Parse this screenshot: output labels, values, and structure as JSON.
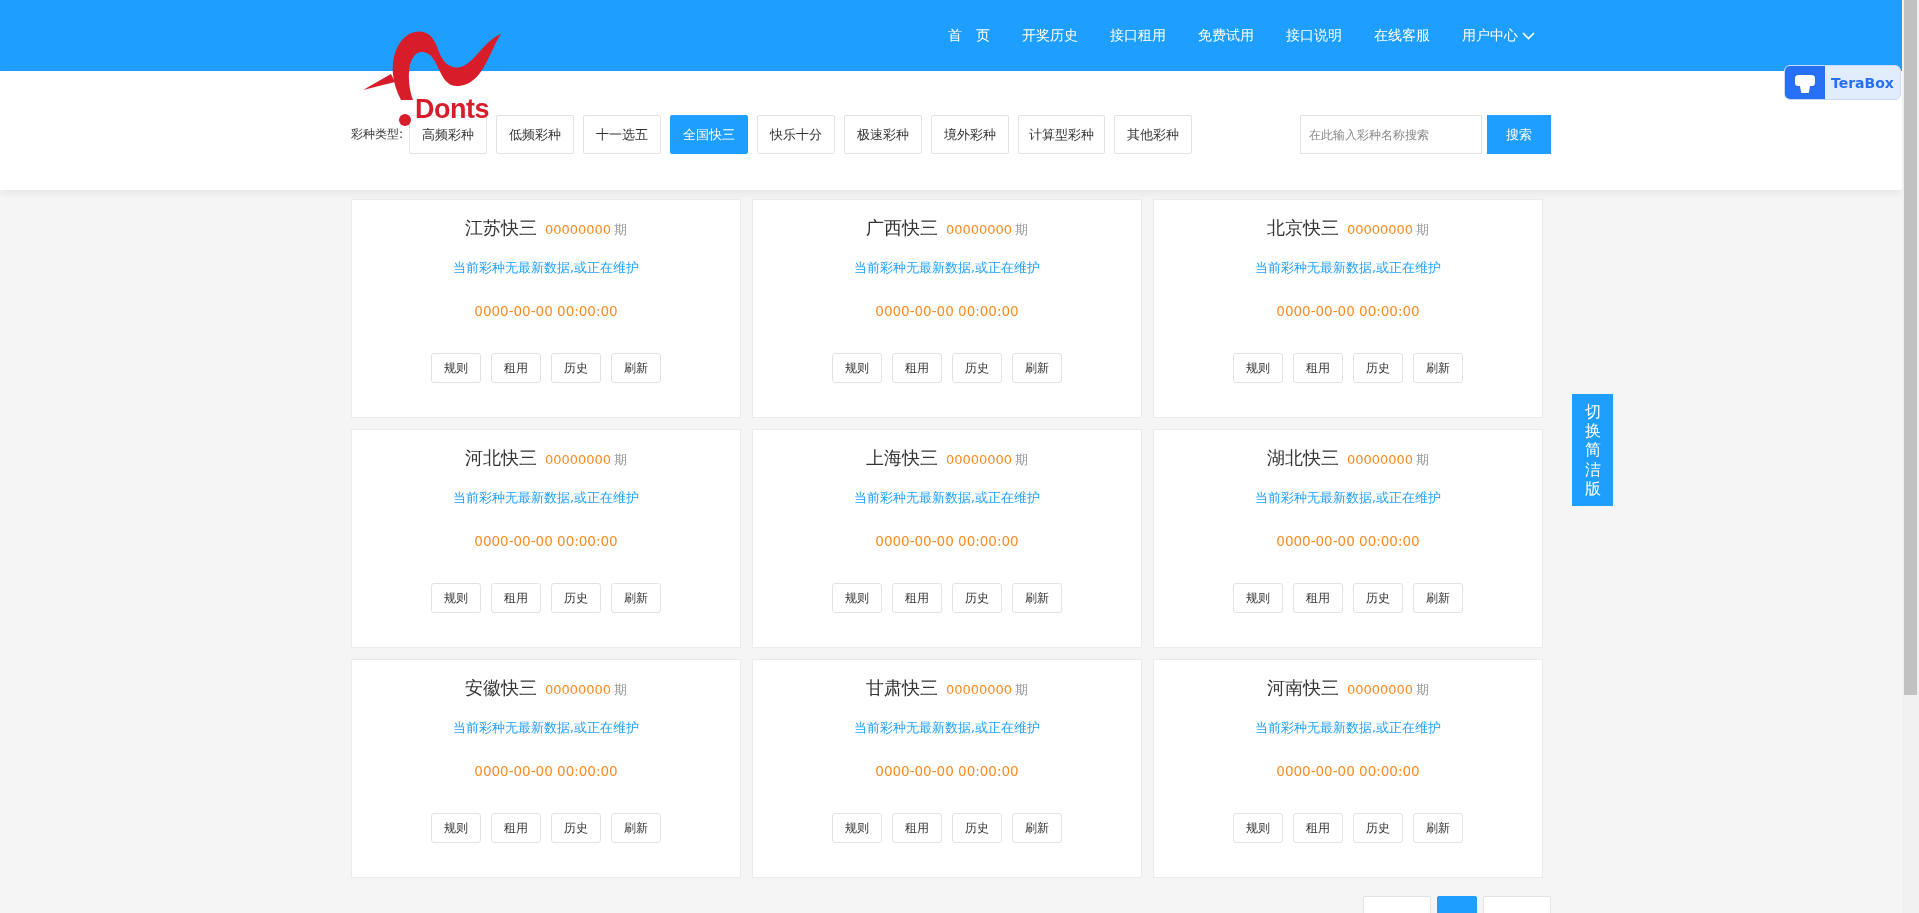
{
  "logo": {
    "text": "Donts"
  },
  "nav": {
    "items": [
      {
        "label": "首　页"
      },
      {
        "label": "开奖历史"
      },
      {
        "label": "接口租用"
      },
      {
        "label": "免费试用"
      },
      {
        "label": "接口说明"
      },
      {
        "label": "在线客服"
      },
      {
        "label": "用户中心",
        "dropdown": true
      }
    ]
  },
  "filter": {
    "label": "彩种类型:",
    "types": [
      {
        "label": "高频彩种",
        "selected": false
      },
      {
        "label": "低频彩种",
        "selected": false
      },
      {
        "label": "十一选五",
        "selected": false
      },
      {
        "label": "全国快三",
        "selected": true
      },
      {
        "label": "快乐十分",
        "selected": false
      },
      {
        "label": "极速彩种",
        "selected": false
      },
      {
        "label": "境外彩种",
        "selected": false
      },
      {
        "label": "计算型彩种",
        "selected": false
      },
      {
        "label": "其他彩种",
        "selected": false
      }
    ],
    "search": {
      "placeholder": "在此输入彩种名称搜索",
      "button": "搜索"
    }
  },
  "cards": [
    {
      "name": "江苏快三",
      "issue": "00000000",
      "issue_unit": "期",
      "message": "当前彩种无最新数据,或正在维护",
      "time": "0000-00-00 00:00:00",
      "actions": [
        "规则",
        "租用",
        "历史",
        "刷新"
      ]
    },
    {
      "name": "广西快三",
      "issue": "00000000",
      "issue_unit": "期",
      "message": "当前彩种无最新数据,或正在维护",
      "time": "0000-00-00 00:00:00",
      "actions": [
        "规则",
        "租用",
        "历史",
        "刷新"
      ]
    },
    {
      "name": "北京快三",
      "issue": "00000000",
      "issue_unit": "期",
      "message": "当前彩种无最新数据,或正在维护",
      "time": "0000-00-00 00:00:00",
      "actions": [
        "规则",
        "租用",
        "历史",
        "刷新"
      ]
    },
    {
      "name": "河北快三",
      "issue": "00000000",
      "issue_unit": "期",
      "message": "当前彩种无最新数据,或正在维护",
      "time": "0000-00-00 00:00:00",
      "actions": [
        "规则",
        "租用",
        "历史",
        "刷新"
      ]
    },
    {
      "name": "上海快三",
      "issue": "00000000",
      "issue_unit": "期",
      "message": "当前彩种无最新数据,或正在维护",
      "time": "0000-00-00 00:00:00",
      "actions": [
        "规则",
        "租用",
        "历史",
        "刷新"
      ]
    },
    {
      "name": "湖北快三",
      "issue": "00000000",
      "issue_unit": "期",
      "message": "当前彩种无最新数据,或正在维护",
      "time": "0000-00-00 00:00:00",
      "actions": [
        "规则",
        "租用",
        "历史",
        "刷新"
      ]
    },
    {
      "name": "安徽快三",
      "issue": "00000000",
      "issue_unit": "期",
      "message": "当前彩种无最新数据,或正在维护",
      "time": "0000-00-00 00:00:00",
      "actions": [
        "规则",
        "租用",
        "历史",
        "刷新"
      ]
    },
    {
      "name": "甘肃快三",
      "issue": "00000000",
      "issue_unit": "期",
      "message": "当前彩种无最新数据,或正在维护",
      "time": "0000-00-00 00:00:00",
      "actions": [
        "规则",
        "租用",
        "历史",
        "刷新"
      ]
    },
    {
      "name": "河南快三",
      "issue": "00000000",
      "issue_unit": "期",
      "message": "当前彩种无最新数据,或正在维护",
      "time": "0000-00-00 00:00:00",
      "actions": [
        "规则",
        "租用",
        "历史",
        "刷新"
      ]
    }
  ],
  "pagination": [
    {
      "selected": false
    },
    {
      "selected": true
    },
    {
      "selected": false
    }
  ],
  "side_button": {
    "label": "切换简洁版"
  },
  "terabox": {
    "label": "TeraBox"
  }
}
